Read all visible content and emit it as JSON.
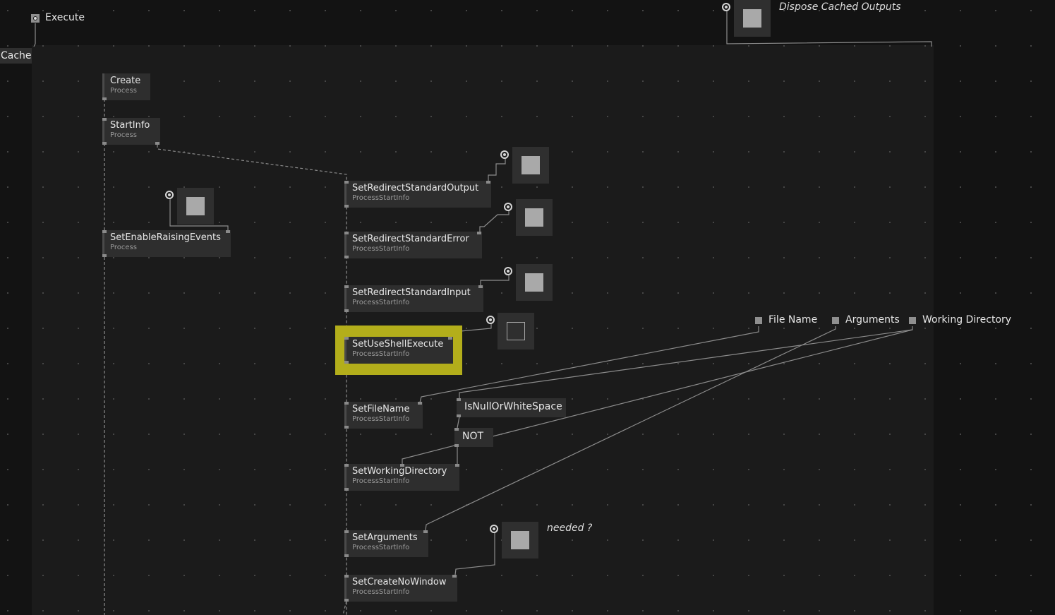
{
  "app": {
    "execute_label": "Execute",
    "cache_label": "Cache",
    "dispose_label": "Dispose Cached Outputs",
    "needed_note": "needed ?"
  },
  "inputs": {
    "file_name": "File Name",
    "arguments": "Arguments",
    "working_directory": "Working Directory"
  },
  "nodes": {
    "create": {
      "title": "Create",
      "sub": "Process"
    },
    "startinfo": {
      "title": "StartInfo",
      "sub": "Process"
    },
    "set_enable_raising_events": {
      "title": "SetEnableRaisingEvents",
      "sub": "Process"
    },
    "set_redirect_stdout": {
      "title": "SetRedirectStandardOutput",
      "sub": "ProcessStartInfo"
    },
    "set_redirect_stderr": {
      "title": "SetRedirectStandardError",
      "sub": "ProcessStartInfo"
    },
    "set_redirect_stdin": {
      "title": "SetRedirectStandardInput",
      "sub": "ProcessStartInfo"
    },
    "set_use_shell_execute": {
      "title": "SetUseShellExecute",
      "sub": "ProcessStartInfo"
    },
    "set_file_name": {
      "title": "SetFileName",
      "sub": "ProcessStartInfo"
    },
    "is_null_or_whitespace": {
      "title": "IsNullOrWhiteSpace"
    },
    "not": {
      "title": "NOT"
    },
    "set_working_directory": {
      "title": "SetWorkingDirectory",
      "sub": "ProcessStartInfo"
    },
    "set_arguments": {
      "title": "SetArguments",
      "sub": "ProcessStartInfo"
    },
    "set_create_no_window": {
      "title": "SetCreateNoWindow",
      "sub": "ProcessStartInfo"
    }
  },
  "toggles": {
    "dispose": true,
    "enable_raising_events": true,
    "redirect_stdout": true,
    "redirect_stderr": true,
    "redirect_stdin": true,
    "use_shell_execute": false,
    "create_no_window": true
  },
  "colors": {
    "background": "#131313",
    "region": "#1b1b1b",
    "node": "#2e2e2e",
    "highlight": "#b3ae1b",
    "wire": "#8c8c8c"
  }
}
